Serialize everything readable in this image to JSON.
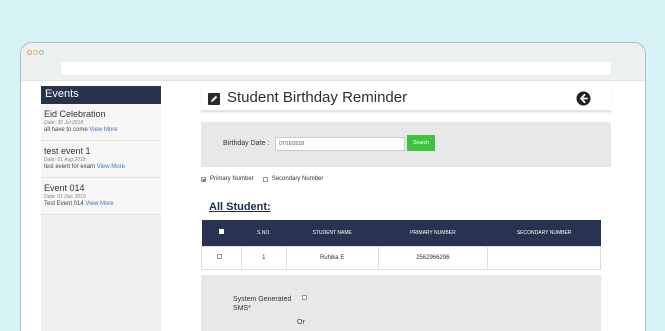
{
  "sidebar": {
    "heading": "Events",
    "events": [
      {
        "title": "Eid Celebration",
        "date": "Date: 30 Jul 2018",
        "desc": "all have to come",
        "link": "View More"
      },
      {
        "title": "test event 1",
        "date": "Date: 01 Aug 2018",
        "desc": "test event for exam",
        "link": "View More"
      },
      {
        "title": "Event 014",
        "date": "Date: 01 Dec 2019",
        "desc": "Test Event 014",
        "link": "View More"
      }
    ]
  },
  "main": {
    "title": "Student Birthday Reminder",
    "filter": {
      "label": "Birthday Date :",
      "date_value": "07/16/2018",
      "search_label": "Search"
    },
    "options": {
      "primary": "Primary Number",
      "secondary": "Secondary Number"
    },
    "section_title": "All Student:",
    "table": {
      "headers": [
        "S.NO.",
        "STUDENT NAME",
        "PRIMARY NUMBER",
        "SECONDARY NUMBER"
      ],
      "rows": [
        {
          "sno": "1",
          "name": "Ruhika E",
          "primary": "2562966296",
          "secondary": ""
        }
      ]
    },
    "sms": {
      "label": "System Generated SMS*",
      "or": "Or"
    }
  },
  "colors": {
    "navy": "#283352",
    "accent_green": "#3fc33f",
    "link_blue": "#3a78c2",
    "backdrop": "#d6f2f4"
  }
}
